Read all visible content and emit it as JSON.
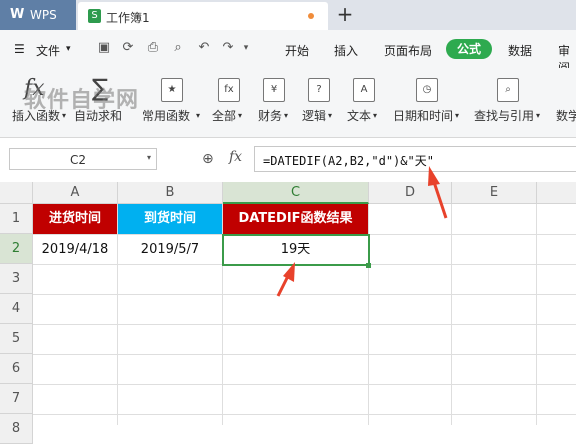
{
  "titlebar": {
    "app_name": "WPS",
    "doc_tab_label": "工作簿1",
    "new_tab_symbol": "+"
  },
  "menubar": {
    "file_label": "文件",
    "tabs": [
      {
        "id": "start",
        "label": "开始"
      },
      {
        "id": "insert",
        "label": "插入"
      },
      {
        "id": "layout",
        "label": "页面布局"
      },
      {
        "id": "formula",
        "label": "公式",
        "active": true
      },
      {
        "id": "data",
        "label": "数据"
      },
      {
        "id": "review",
        "label": "审阅"
      }
    ]
  },
  "ribbon": {
    "watermark": "软件自学网",
    "buttons": [
      {
        "id": "insert-function",
        "label": "插入函数"
      },
      {
        "id": "autosum",
        "label": "自动求和"
      },
      {
        "id": "common-functions",
        "label": "常用函数"
      },
      {
        "id": "all",
        "label": "全部",
        "icon_text": "fx"
      },
      {
        "id": "finance",
        "label": "财务",
        "icon_text": "¥"
      },
      {
        "id": "logic",
        "label": "逻辑",
        "icon_text": "?"
      },
      {
        "id": "text",
        "label": "文本",
        "icon_text": "A"
      },
      {
        "id": "datetime",
        "label": "日期和时间",
        "icon_text": "◷"
      },
      {
        "id": "lookup",
        "label": "查找与引用",
        "icon_text": "⌕"
      },
      {
        "id": "math",
        "label": "数学"
      }
    ]
  },
  "formulabar": {
    "name_box": "C2",
    "fx_label": "fx",
    "formula": "=DATEDIF(A2,B2,\"d\")&\"天\""
  },
  "sheet": {
    "columns": [
      "A",
      "B",
      "C",
      "D",
      "E"
    ],
    "rows": [
      "1",
      "2",
      "3",
      "4",
      "5",
      "6",
      "7",
      "8"
    ],
    "selected_cell": "C2",
    "header_row": [
      {
        "text": "进货时间",
        "bg": "#c00000"
      },
      {
        "text": "到货时间",
        "bg": "#00b0f0"
      },
      {
        "text": "DATEDIF函数结果",
        "bg": "#c00000"
      }
    ],
    "data_row": [
      "2019/4/18",
      "2019/5/7",
      "19天"
    ]
  },
  "colors": {
    "accent_green": "#2eaa4f",
    "annotation_arrow": "#e8422b"
  }
}
